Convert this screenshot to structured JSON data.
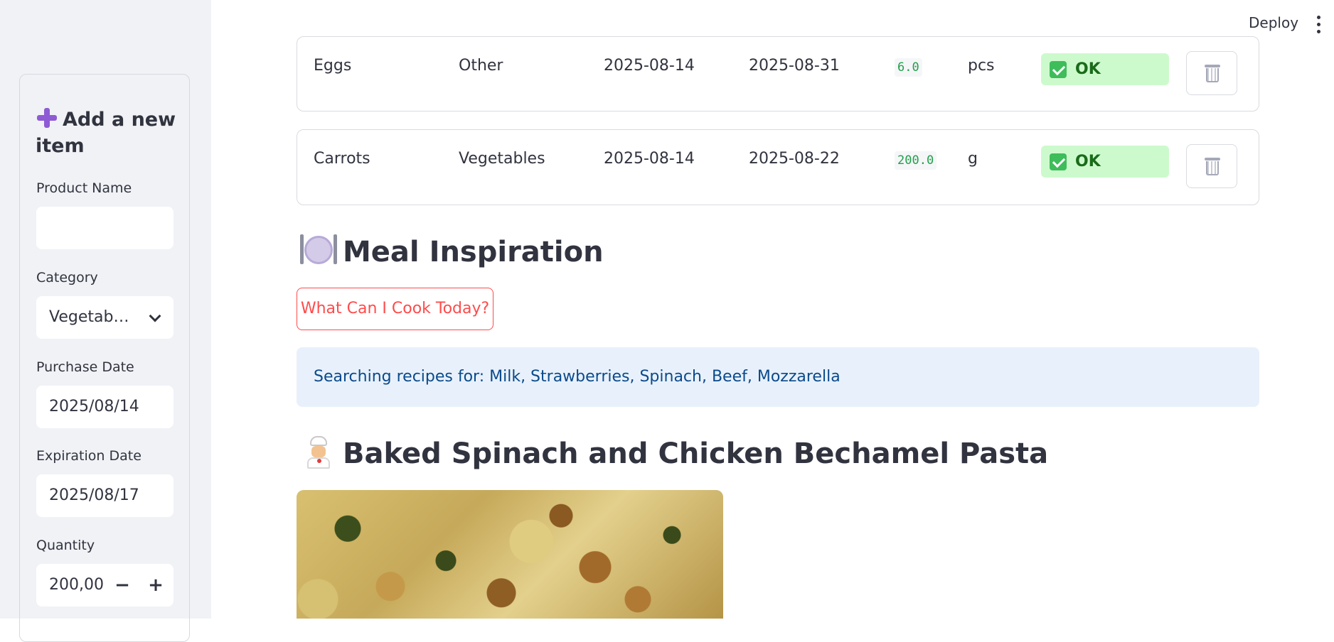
{
  "topbar": {
    "deploy_label": "Deploy"
  },
  "sidebar": {
    "form_title": "Add a new item",
    "product_name": {
      "label": "Product Name",
      "value": ""
    },
    "category": {
      "label": "Category",
      "value": "Vegetab…"
    },
    "purchase_date": {
      "label": "Purchase Date",
      "value": "2025/08/14"
    },
    "expiration_date": {
      "label": "Expiration Date",
      "value": "2025/08/17"
    },
    "quantity": {
      "label": "Quantity",
      "value": "200,00",
      "minus": "−",
      "plus": "+"
    }
  },
  "inventory": {
    "rows": [
      {
        "name": "Eggs",
        "category": "Other",
        "purchased": "2025-08-14",
        "expires": "2025-08-31",
        "quantity": "6.0",
        "unit": "pcs",
        "status": "OK"
      },
      {
        "name": "Carrots",
        "category": "Vegetables",
        "purchased": "2025-08-14",
        "expires": "2025-08-22",
        "quantity": "200.0",
        "unit": "g",
        "status": "OK"
      }
    ]
  },
  "meal": {
    "heading": "Meal Inspiration",
    "cook_button": "What Can I Cook Today?",
    "info": "Searching recipes for: Milk, Strawberries, Spinach, Beef, Mozzarella",
    "recipe_title": "Baked Spinach and Chicken Bechamel Pasta"
  },
  "colors": {
    "accent": "#ff4b4b",
    "ok_bg": "#cdfacd",
    "info_bg": "#e8f1fb",
    "sidebar_bg": "#f0f2f6"
  }
}
